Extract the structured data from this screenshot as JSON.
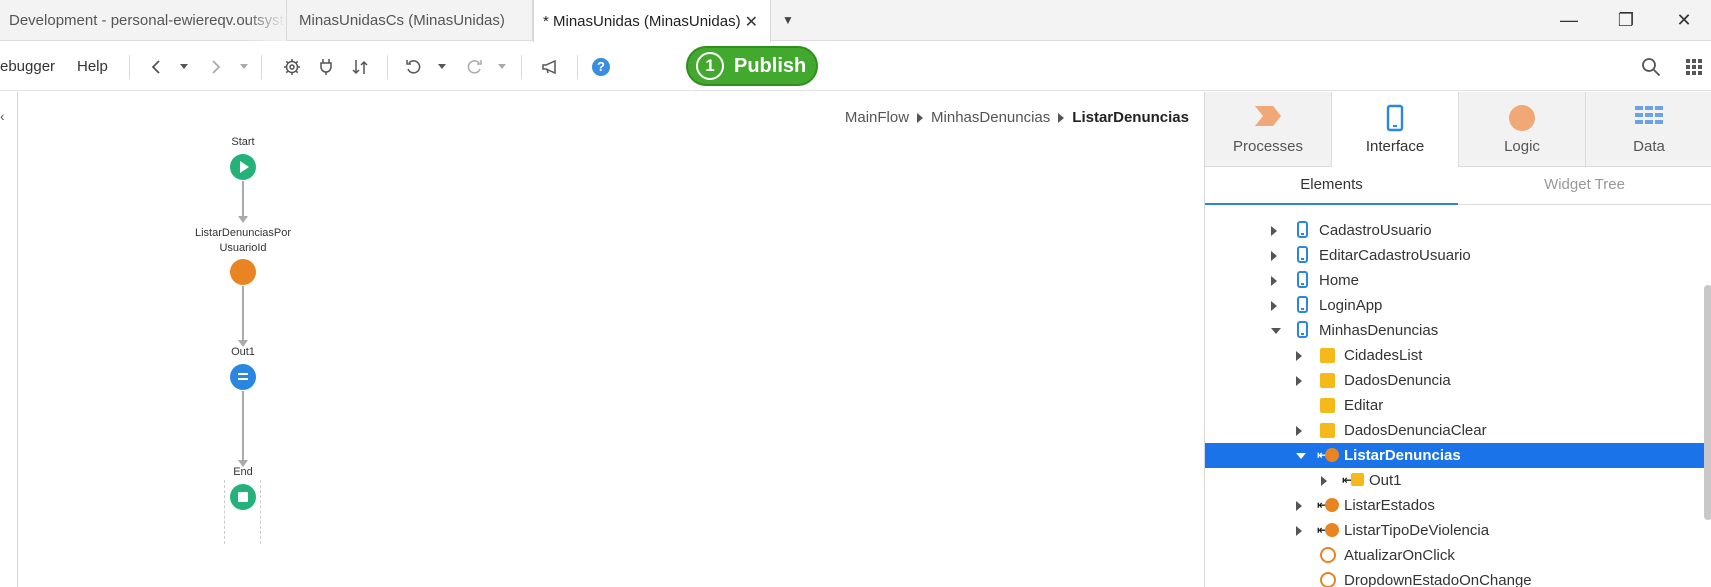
{
  "tabs": [
    {
      "label": "Development - personal-ewiereqv.outsystemscloud.com"
    },
    {
      "label": "MinasUnidasCs (MinasUnidas)"
    },
    {
      "label": "* MinasUnidas (MinasUnidas)"
    }
  ],
  "window": {
    "minimize": "—",
    "restore": "❐",
    "close": "✕"
  },
  "toolbar": {
    "menu": [
      "ebugger",
      "Help"
    ],
    "publish_number": "1",
    "publish_label": "Publish",
    "help_label": "?"
  },
  "breadcrumb": [
    "MainFlow",
    "MinhasDenuncias",
    "ListarDenuncias"
  ],
  "flow": {
    "start": "Start",
    "aggregate": [
      "ListarDenunciasPor",
      "UsuarioId"
    ],
    "assign": "Out1",
    "end": "End"
  },
  "panel": {
    "tabs": [
      {
        "label": "Processes",
        "icon": "processes-icon"
      },
      {
        "label": "Interface",
        "icon": "interface-icon"
      },
      {
        "label": "Logic",
        "icon": "logic-icon"
      },
      {
        "label": "Data",
        "icon": "data-icon"
      }
    ],
    "subtabs": [
      "Elements",
      "Widget Tree"
    ]
  },
  "tree": [
    {
      "label": "CadastroUsuario",
      "icon": "screen",
      "level": 0,
      "exp": "closed"
    },
    {
      "label": "EditarCadastroUsuario",
      "icon": "screen",
      "level": 0,
      "exp": "closed"
    },
    {
      "label": "Home",
      "icon": "screen",
      "level": 0,
      "exp": "closed"
    },
    {
      "label": "LoginApp",
      "icon": "screen-home",
      "level": 0,
      "exp": "closed"
    },
    {
      "label": "MinhasDenuncias",
      "icon": "screen",
      "level": 0,
      "exp": "open"
    },
    {
      "label": "CidadesList",
      "icon": "var",
      "level": 1,
      "exp": "closed"
    },
    {
      "label": "DadosDenuncia",
      "icon": "var",
      "level": 1,
      "exp": "closed"
    },
    {
      "label": "Editar",
      "icon": "var",
      "level": 1,
      "exp": "none"
    },
    {
      "label": "DadosDenunciaClear",
      "icon": "var",
      "level": 1,
      "exp": "closed"
    },
    {
      "label": "ListarDenuncias",
      "icon": "agg",
      "level": 1,
      "exp": "open",
      "selected": true
    },
    {
      "label": "Out1",
      "icon": "out",
      "level": 2,
      "exp": "closed"
    },
    {
      "label": "ListarEstados",
      "icon": "agg",
      "level": 1,
      "exp": "closed"
    },
    {
      "label": "ListarTipoDeViolencia",
      "icon": "agg",
      "level": 1,
      "exp": "closed"
    },
    {
      "label": "AtualizarOnClick",
      "icon": "action",
      "level": 1,
      "exp": "none"
    },
    {
      "label": "DropdownEstadoOnChange",
      "icon": "action",
      "level": 1,
      "exp": "none"
    }
  ]
}
